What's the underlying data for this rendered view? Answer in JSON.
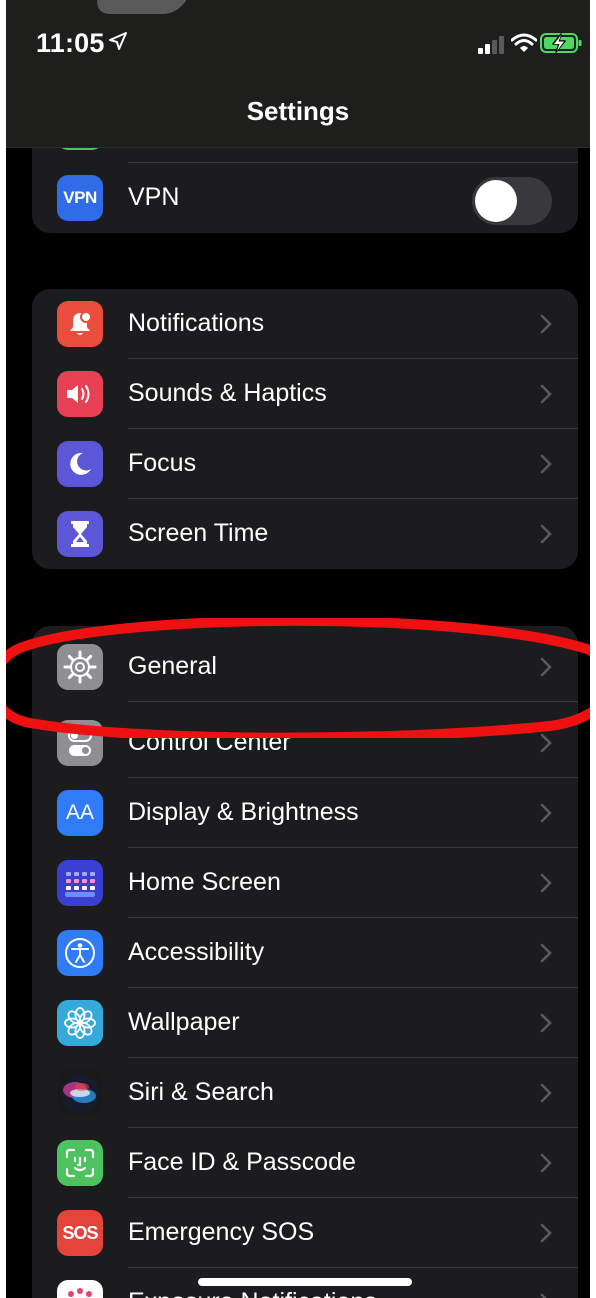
{
  "status_bar": {
    "time": "11:05"
  },
  "header": {
    "title": "Settings"
  },
  "vpn_group": {
    "vpn": {
      "label": "VPN",
      "icon_text": "VPN",
      "icon": "vpn-icon",
      "color": "#2f6ce5",
      "toggle_on": false
    }
  },
  "group2": {
    "items": [
      {
        "label": "Notifications",
        "icon": "bell-icon",
        "color": "#eb4d3d"
      },
      {
        "label": "Sounds & Haptics",
        "icon": "speaker-icon",
        "color": "#e84055"
      },
      {
        "label": "Focus",
        "icon": "moon-icon",
        "color": "#5b57d6"
      },
      {
        "label": "Screen Time",
        "icon": "hourglass-icon",
        "color": "#5b57d6"
      }
    ]
  },
  "group3": {
    "items": [
      {
        "label": "General",
        "icon": "gear-icon",
        "color": "#8e8e93"
      },
      {
        "label": "Control Center",
        "icon": "toggles-icon",
        "color": "#8e8e93"
      },
      {
        "label": "Display & Brightness",
        "icon": "text-size-icon",
        "icon_text": "AA",
        "color": "#2f7cf6"
      },
      {
        "label": "Home Screen",
        "icon": "home-grid-icon",
        "color": "#3a3fd1"
      },
      {
        "label": "Accessibility",
        "icon": "accessibility-icon",
        "color": "#2f7cf6"
      },
      {
        "label": "Wallpaper",
        "icon": "flower-icon",
        "color": "#35a9d9"
      },
      {
        "label": "Siri & Search",
        "icon": "siri-icon",
        "color": "#1a1a1a"
      },
      {
        "label": "Face ID & Passcode",
        "icon": "face-id-icon",
        "color": "#4cc35e"
      },
      {
        "label": "Emergency SOS",
        "icon": "sos-icon",
        "icon_text": "SOS",
        "color": "#e4443a"
      },
      {
        "label": "Exposure Notifications",
        "icon": "exposure-icon",
        "color": "#ffffff"
      }
    ]
  },
  "annotation": {
    "color": "#ee1111",
    "target": "General"
  }
}
